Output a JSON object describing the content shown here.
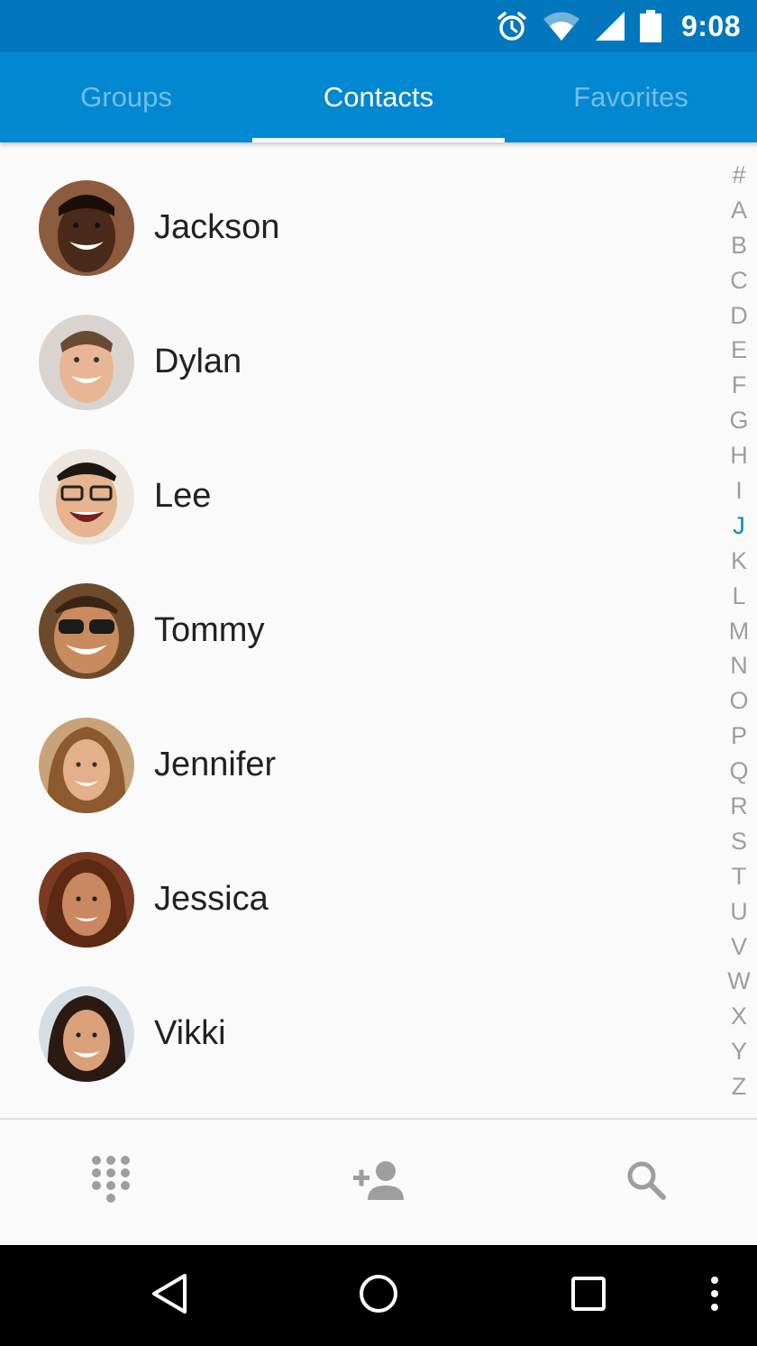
{
  "status_bar": {
    "time": "9:08",
    "icons": [
      "alarm-icon",
      "wifi-icon",
      "cell-signal-icon",
      "battery-icon"
    ]
  },
  "tabs": [
    {
      "label": "Groups",
      "active": false
    },
    {
      "label": "Contacts",
      "active": true
    },
    {
      "label": "Favorites",
      "active": false
    }
  ],
  "contacts": [
    {
      "name": "Jackson"
    },
    {
      "name": "Dylan"
    },
    {
      "name": "Lee"
    },
    {
      "name": "Tommy"
    },
    {
      "name": "Jennifer"
    },
    {
      "name": "Jessica"
    },
    {
      "name": "Vikki"
    }
  ],
  "alphabet_index": {
    "letters": [
      "#",
      "A",
      "B",
      "C",
      "D",
      "E",
      "F",
      "G",
      "H",
      "I",
      "J",
      "K",
      "L",
      "M",
      "N",
      "O",
      "P",
      "Q",
      "R",
      "S",
      "T",
      "U",
      "V",
      "W",
      "X",
      "Y",
      "Z"
    ],
    "active": "J"
  },
  "bottom_actions": [
    "dialpad-icon",
    "add-contact-icon",
    "search-icon"
  ],
  "nav_buttons": [
    "back-icon",
    "home-icon",
    "recents-icon",
    "overflow-menu-icon"
  ],
  "colors": {
    "status_bar": "#0277bd",
    "tab_bar": "#0288d1",
    "accent": "#0288d1",
    "text_primary": "#212121",
    "icon_gray": "#9e9e9e"
  }
}
